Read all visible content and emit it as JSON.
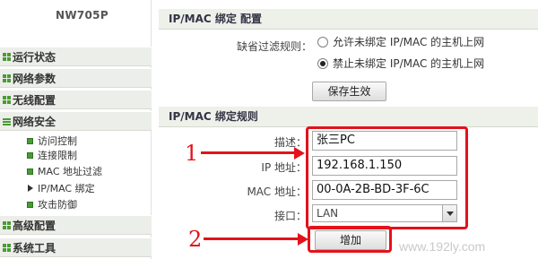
{
  "sidebar": {
    "model": "NW705P",
    "items": [
      {
        "label": "运行状态"
      },
      {
        "label": "网络参数"
      },
      {
        "label": "无线配置"
      },
      {
        "label": "网络安全"
      },
      {
        "label": "高级配置"
      },
      {
        "label": "系统工具"
      }
    ],
    "sub_items": [
      {
        "label": "访问控制"
      },
      {
        "label": "连接限制"
      },
      {
        "label": "MAC 地址过滤"
      },
      {
        "label": "IP/MAC 绑定"
      },
      {
        "label": "攻击防御"
      }
    ]
  },
  "config_section": {
    "title": "IP/MAC 绑定 配置",
    "default_filter_label": "缺省过滤规则：",
    "options": [
      {
        "label": "允许未绑定 IP/MAC 的主机上网",
        "selected": false
      },
      {
        "label": "禁止未绑定 IP/MAC 的主机上网",
        "selected": true
      }
    ],
    "save_button": "保存生效"
  },
  "rules_section": {
    "title": "IP/MAC 绑定规则",
    "fields": {
      "description": {
        "label": "描述：",
        "value": "张三PC"
      },
      "ip": {
        "label": "IP 地址：",
        "value": "192.168.1.150"
      },
      "mac": {
        "label": "MAC 地址：",
        "value": "00-0A-2B-BD-3F-6C"
      },
      "interface": {
        "label": "接口：",
        "value": "LAN"
      }
    },
    "add_button": "增加"
  },
  "annotations": {
    "number_1": "1",
    "number_2": "2",
    "color": "#e3121b"
  },
  "watermark": "www.192ly.com",
  "colors": {
    "accent_green": "#4a9b33",
    "header_bg": "#eef0ea"
  }
}
